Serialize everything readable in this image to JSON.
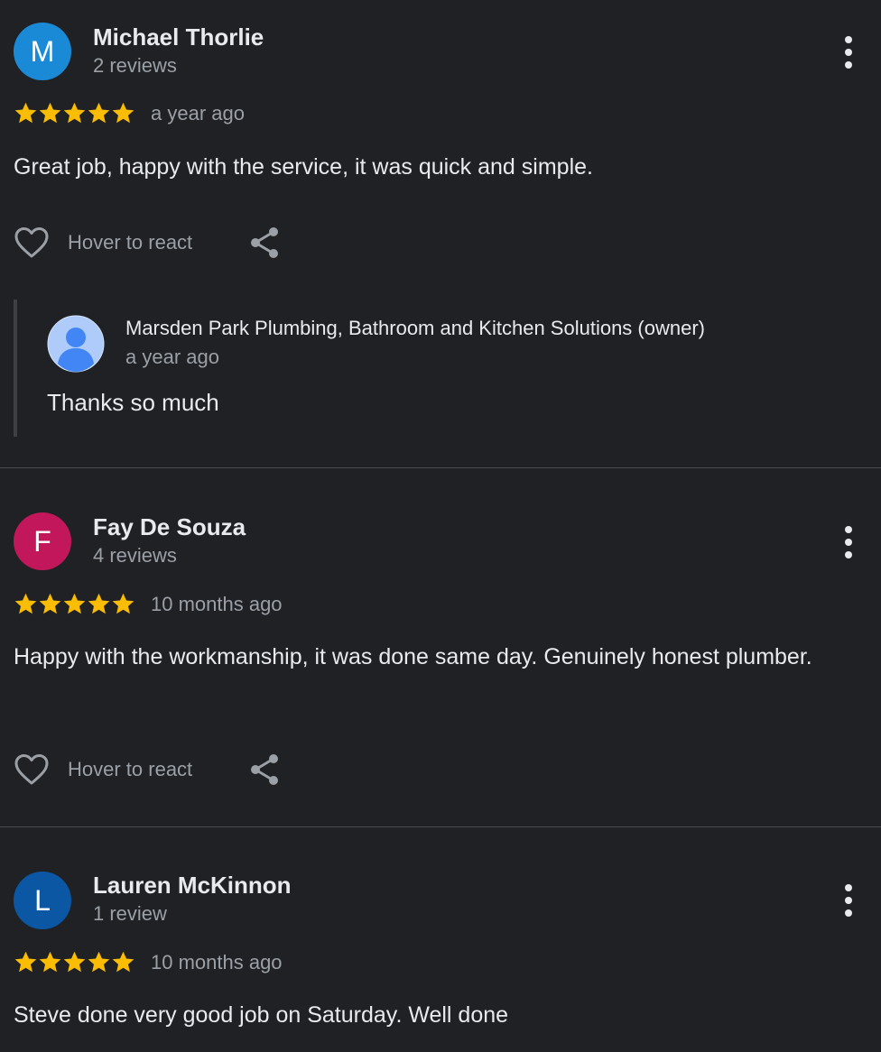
{
  "colors": {
    "background": "#202124",
    "star": "#fbbc04",
    "avatar_m": "#1a8ad6",
    "avatar_f": "#c2185b",
    "avatar_l": "#0b57a4"
  },
  "reviews": [
    {
      "initial": "M",
      "name": "Michael Thorlie",
      "review_count": "2 reviews",
      "rating": 5,
      "time": "a year ago",
      "text": "Great job, happy with the service, it was quick and simple.",
      "react_label": "Hover to react",
      "owner_reply": {
        "name": "Marsden Park Plumbing, Bathroom and Kitchen Solutions (owner)",
        "time": "a year ago",
        "text": "Thanks so much"
      }
    },
    {
      "initial": "F",
      "name": "Fay De Souza",
      "review_count": "4 reviews",
      "rating": 5,
      "time": "10 months ago",
      "text": "Happy with the workmanship, it was done same day. Genuinely honest plumber.",
      "react_label": "Hover to react"
    },
    {
      "initial": "L",
      "name": "Lauren McKinnon",
      "review_count": "1 review",
      "rating": 5,
      "time": "10 months ago",
      "text": "Steve done very good job on Saturday. Well done"
    }
  ]
}
